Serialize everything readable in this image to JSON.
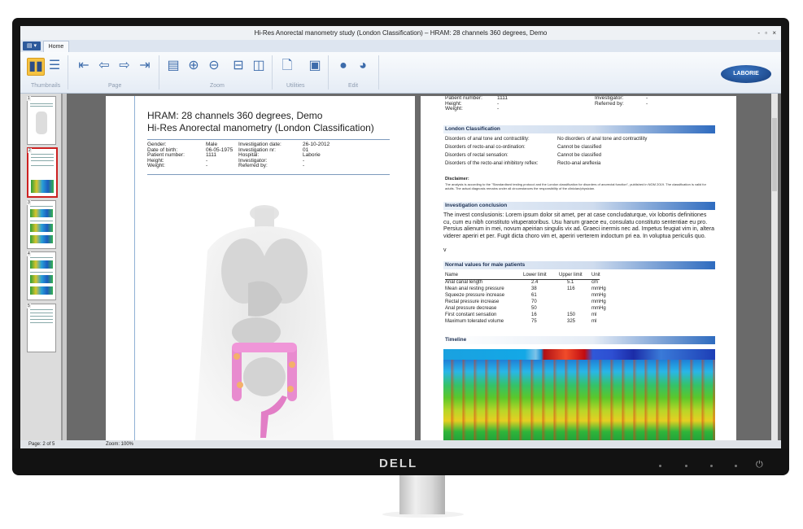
{
  "window": {
    "title": "Hi-Res Anorectal manometry study (London Classification) – HRAM: 28 channels 360 degrees, Demo",
    "controls": "- ▫ ×"
  },
  "tabs": {
    "menu_label": "▤ ▾",
    "home": "Home"
  },
  "ribbon": {
    "groups": [
      "Thumbnails",
      "Page",
      "Zoom",
      "Utilities",
      "Edit"
    ],
    "logo": "LABORIE",
    "icons": [
      "thumbnails-icon",
      "list-icon",
      "first-page-icon",
      "prev-page-icon",
      "next-page-icon",
      "last-page-icon",
      "page-zoom-icon",
      "zoom-in-icon",
      "zoom-out-icon",
      "fit-width-icon",
      "fit-height-icon",
      "export-icon",
      "print-icon",
      "comment-icon",
      "edit-icon"
    ]
  },
  "thumbnails": [
    "1",
    "2",
    "3",
    "4",
    "5"
  ],
  "status": {
    "page": "Page: 2 of 5",
    "zoom": "Zoom: 100%"
  },
  "page1": {
    "title": "HRAM: 28 channels 360 degrees, Demo",
    "subtitle": "Hi-Res Anorectal manometry (London Classification)",
    "left_labels": [
      "Gender:",
      "Date of birth:",
      "Patient number:",
      "Height:",
      "Weight:"
    ],
    "left_values": [
      "Male",
      "06-05-1975",
      "1111",
      "-",
      "-"
    ],
    "right_labels": [
      "Investigation date:",
      "Investigation nr:",
      "Hospital:",
      "Investigator:",
      "Referred by:"
    ],
    "right_values": [
      "26-10-2012",
      "01",
      "Laborie",
      "-",
      "-"
    ]
  },
  "page2": {
    "top_labels": [
      "Patient number:",
      "Height:",
      "Weight:"
    ],
    "top_values": [
      "1111",
      "-",
      "-"
    ],
    "top_right_labels": [
      "Investigator:",
      "Referred by:"
    ],
    "top_right_values": [
      "-",
      "-"
    ],
    "london_heading": "London Classification",
    "london_rows": [
      {
        "label": "Disorders of anal tone and contractility:",
        "value": "No disorders of anal tone and contractility"
      },
      {
        "label": "Disorders of recto-anal co-ordination:",
        "value": "Cannot be classified"
      },
      {
        "label": "Disorders of rectal sensation:",
        "value": "Cannot be classified"
      },
      {
        "label": "Disorders of the recto-anal inhibitory reflex:",
        "value": "Recto-anal areflexia"
      }
    ],
    "disclaimer_title": "Disclaimer:",
    "disclaimer_text": "The analysis is according to the \"Standardised testing protocol and the London classification for disorders of anorectal function\", published in NGM 2019. The classification is valid for adults. The actual diagnosis remains under all circumstances the responsibility of the clinician/physician.",
    "conclusion_heading": "Investigation conclusion",
    "conclusion_text": "The invest conslusionis: Lorem ipsum dolor sit amet, per at case concludaturque, vix lobortis definitiones cu, cum eu nibh constituto vituperatoribus. Usu harum graece eu, consulatu constituto sententiae eu pro. Persius alienum in mei, novum apeirian singulis vix ad. Graeci inermis nec ad. Impetus feugiat vim in, altera viderer aperiri et per. Fugit dicta choro vim et, aperiri verterem indoctum pri ea. In voluptua periculis quo.",
    "conclusion_tail": "v",
    "normal_heading": "Normal values for male patients",
    "normal_columns": [
      "Name",
      "Lower limit",
      "Upper limit",
      "Unit"
    ],
    "normal_rows": [
      {
        "name": "Anal canal length",
        "lower": "2.4",
        "upper": "5.1",
        "unit": "cm"
      },
      {
        "name": "Mean anal resting pressure",
        "lower": "38",
        "upper": "116",
        "unit": "mmHg"
      },
      {
        "name": "Squeeze pressure increase",
        "lower": "61",
        "upper": "",
        "unit": "mmHg"
      },
      {
        "name": "Rectal pressure increase",
        "lower": "70",
        "upper": "",
        "unit": "mmHg"
      },
      {
        "name": "Anal pressure decrease",
        "lower": "50",
        "upper": "",
        "unit": "mmHg"
      },
      {
        "name": "First constant sensation",
        "lower": "16",
        "upper": "150",
        "unit": "ml"
      },
      {
        "name": "Maximum tolerated volume",
        "lower": "75",
        "upper": "325",
        "unit": "ml"
      }
    ],
    "timeline_heading": "Timeline"
  },
  "monitor": {
    "brand": "DELL",
    "power_icon": "⏻"
  }
}
